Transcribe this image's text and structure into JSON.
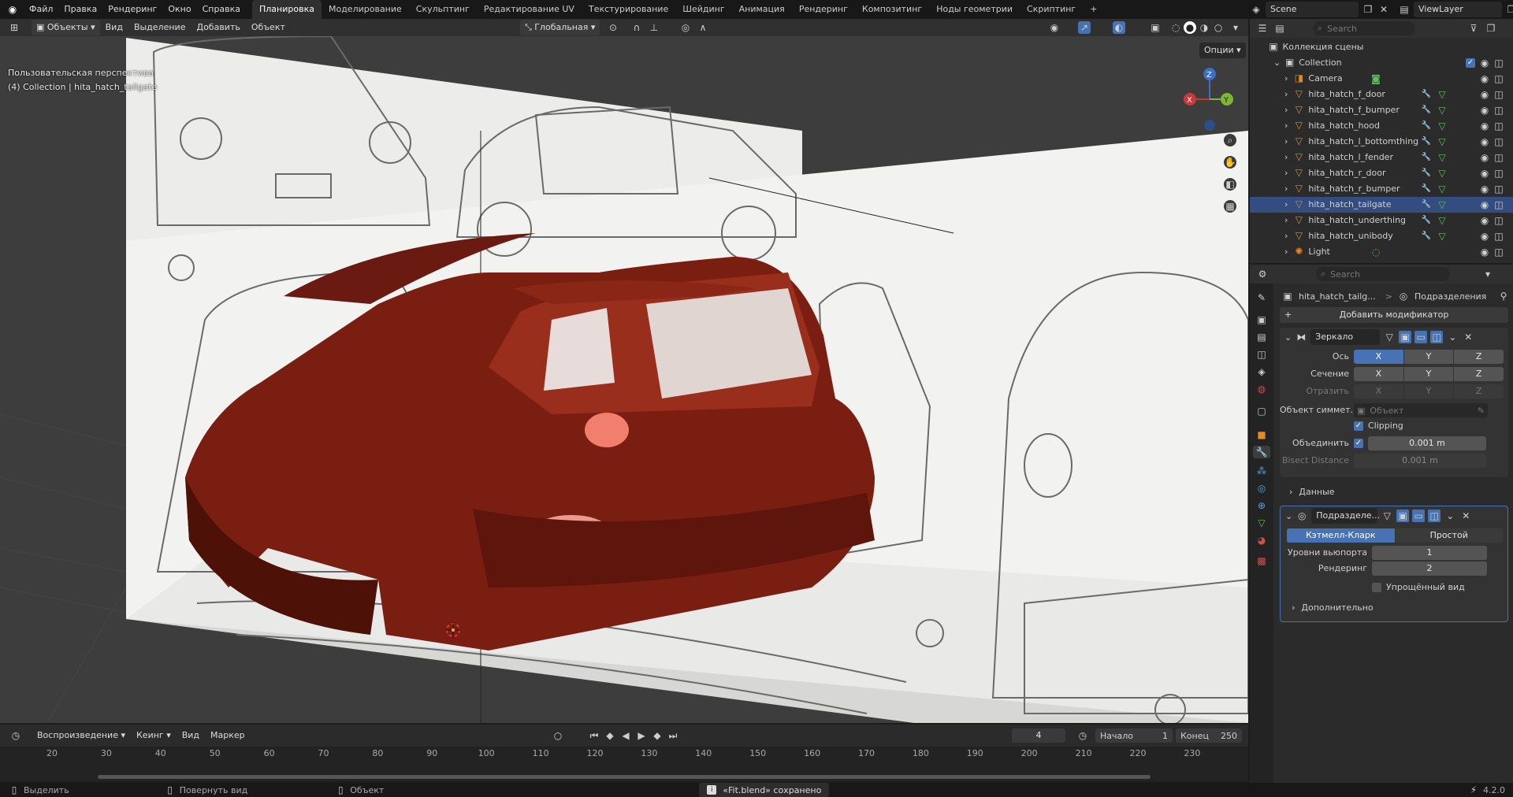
{
  "menubar": {
    "items": [
      "Файл",
      "Правка",
      "Рендеринг",
      "Окно",
      "Справка"
    ],
    "workspaces": [
      "Планировка",
      "Моделирование",
      "Скульптинг",
      "Редактирование UV",
      "Текстурирование",
      "Шейдинг",
      "Анимация",
      "Рендеринг",
      "Композитинг",
      "Ноды геометрии",
      "Скриптинг"
    ],
    "active_workspace": "Планировка",
    "add_tab": "+",
    "scene": "Scene",
    "view_layer": "ViewLayer"
  },
  "viewport": {
    "mode": "Объекты",
    "menus": [
      "Вид",
      "Выделение",
      "Добавить",
      "Объект"
    ],
    "orientation": "Глобальная",
    "options": "Опции",
    "overlay_title": "Пользовательская перспектива",
    "overlay_subtitle": "(4) Collection | hita_hatch_tailgate",
    "gizmo": {
      "x": "X",
      "y": "Y",
      "z": "Z"
    },
    "body_color": "#7a1e12",
    "selection_color": "#ffa826"
  },
  "outliner": {
    "search_placeholder": "Search",
    "root": "Коллекция сцены",
    "collection": "Collection",
    "items": [
      {
        "name": "Camera",
        "type": "camera"
      },
      {
        "name": "hita_hatch_f_door",
        "type": "mesh"
      },
      {
        "name": "hita_hatch_f_bumper",
        "type": "mesh"
      },
      {
        "name": "hita_hatch_hood",
        "type": "mesh"
      },
      {
        "name": "hita_hatch_l_bottomthing",
        "type": "mesh"
      },
      {
        "name": "hita_hatch_l_fender",
        "type": "mesh"
      },
      {
        "name": "hita_hatch_r_door",
        "type": "mesh"
      },
      {
        "name": "hita_hatch_r_bumper",
        "type": "mesh"
      },
      {
        "name": "hita_hatch_tailgate",
        "type": "mesh",
        "active": true
      },
      {
        "name": "hita_hatch_underthing",
        "type": "mesh"
      },
      {
        "name": "hita_hatch_unibody",
        "type": "mesh"
      },
      {
        "name": "Light",
        "type": "light"
      }
    ]
  },
  "properties": {
    "search_placeholder": "Search",
    "breadcrumb_object": "hita_hatch_tailg...",
    "breadcrumb_sep": ">",
    "breadcrumb_modifier": "Подразделения",
    "add_modifier": "Добавить модификатор",
    "mirror": {
      "name": "Зеркало",
      "axis_label": "Ось",
      "bisect_label": "Сечение",
      "flip_label": "Отразить",
      "axes": [
        "X",
        "Y",
        "Z"
      ],
      "mirror_object_label": "Объект симмет...",
      "mirror_object_placeholder": "Объект",
      "clipping_label": "Clipping",
      "merge_label": "Объединить",
      "merge_value": "0.001 m",
      "bisect_distance_label": "Bisect Distance",
      "bisect_distance_value": "0.001 m",
      "data_label": "Данные"
    },
    "subdivision": {
      "name": "Подразделе...",
      "catmull": "Кэтмелл-Кларк",
      "simple": "Простой",
      "viewport_levels_label": "Уровни вьюпорта",
      "viewport_levels": "1",
      "render_label": "Рендеринг",
      "render_levels": "2",
      "simplified_label": "Упрощённый вид",
      "advanced_label": "Дополнительно"
    }
  },
  "timeline": {
    "playback": "Воспроизведение",
    "keying": "Кеинг",
    "view": "Вид",
    "marker": "Маркер",
    "current_frame": "4",
    "start_label": "Начало",
    "start": "1",
    "end_label": "Конец",
    "end": "250",
    "ticks": [
      "20",
      "30",
      "40",
      "50",
      "60",
      "70",
      "80",
      "90",
      "100",
      "110",
      "120",
      "130",
      "140",
      "150",
      "160",
      "170",
      "180",
      "190",
      "200",
      "210",
      "220",
      "230"
    ]
  },
  "statusbar": {
    "select": "Выделить",
    "rotate": "Повернуть вид",
    "object": "Объект",
    "saved": "«Fit.blend» сохранено",
    "version": "4.2.0"
  }
}
